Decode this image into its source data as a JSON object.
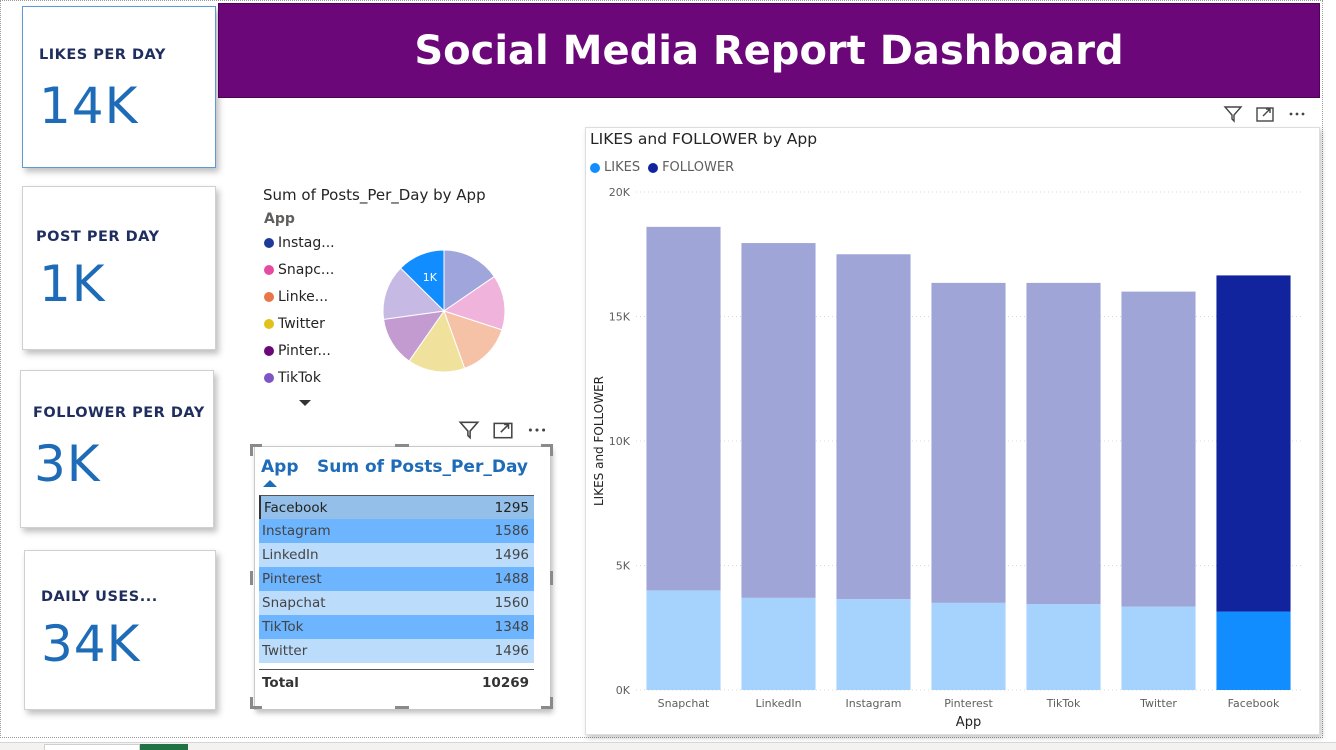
{
  "header": {
    "title": "Social Media Report Dashboard"
  },
  "kpis": [
    {
      "label": "LIKES PER DAY",
      "value": "14K"
    },
    {
      "label": "POST PER DAY",
      "value": "1K"
    },
    {
      "label": "FOLLOWER PER DAY",
      "value": "3K"
    },
    {
      "label": "DAILY USES...",
      "value": "34K"
    }
  ],
  "pie": {
    "title": "Sum of Posts_Per_Day by App",
    "legend_title": "App",
    "legend": [
      {
        "label": "Instag...",
        "color": "#1f3b9a"
      },
      {
        "label": "Snapc...",
        "color": "#e64ba4"
      },
      {
        "label": "Linke...",
        "color": "#e8764a"
      },
      {
        "label": "Twitter",
        "color": "#e0c21b"
      },
      {
        "label": "Pinter...",
        "color": "#6b0778"
      },
      {
        "label": "TikTok",
        "color": "#7e55c4"
      }
    ],
    "highlight_label": "1K"
  },
  "table": {
    "headers": [
      "App",
      "Sum of Posts_Per_Day"
    ],
    "rows": [
      {
        "app": "Facebook",
        "value": "1295"
      },
      {
        "app": "Instagram",
        "value": "1586"
      },
      {
        "app": "LinkedIn",
        "value": "1496"
      },
      {
        "app": "Pinterest",
        "value": "1488"
      },
      {
        "app": "Snapchat",
        "value": "1560"
      },
      {
        "app": "TikTok",
        "value": "1348"
      },
      {
        "app": "Twitter",
        "value": "1496"
      }
    ],
    "total_label": "Total",
    "total_value": "10269"
  },
  "bar_chart": {
    "title": "LIKES and FOLLOWER by App",
    "legend": [
      {
        "label": "LIKES",
        "color": "#118dff"
      },
      {
        "label": "FOLLOWER",
        "color": "#12239e"
      }
    ]
  },
  "chart_data": [
    {
      "type": "pie",
      "title": "Sum of Posts_Per_Day by App",
      "categories": [
        "Facebook",
        "Instagram",
        "LinkedIn",
        "Pinterest",
        "Snapchat",
        "TikTok",
        "Twitter"
      ],
      "values": [
        1295,
        1586,
        1496,
        1488,
        1560,
        1348,
        1496
      ],
      "colors": [
        "#118dff",
        "#a0a6dc",
        "#f0b3dc",
        "#f5c2a8",
        "#f0e29c",
        "#c39bd0",
        "#c6b9e4"
      ],
      "highlighted": "Facebook",
      "data_label": "1K"
    },
    {
      "type": "bar",
      "stacked": true,
      "title": "LIKES and FOLLOWER by App",
      "xlabel": "App",
      "ylabel": "LIKES and FOLLOWER",
      "categories": [
        "Snapchat",
        "LinkedIn",
        "Instagram",
        "Pinterest",
        "TikTok",
        "Twitter",
        "Facebook"
      ],
      "series": [
        {
          "name": "LIKES",
          "values": [
            4000,
            3700,
            3650,
            3500,
            3450,
            3350,
            3150
          ]
        },
        {
          "name": "FOLLOWER",
          "values": [
            14600,
            14250,
            13850,
            12850,
            12900,
            12650,
            13500
          ]
        }
      ],
      "ylim": [
        0,
        20000
      ],
      "yticks": [
        "0K",
        "5K",
        "10K",
        "15K",
        "20K"
      ],
      "ytick_values": [
        0,
        5000,
        10000,
        15000,
        20000
      ],
      "highlighted": "Facebook",
      "dim_colors": [
        "#a5d3fd",
        "#a0a5d8"
      ],
      "full_colors": [
        "#118dff",
        "#12239e"
      ],
      "grid": true,
      "legend_position": "top-left"
    }
  ]
}
